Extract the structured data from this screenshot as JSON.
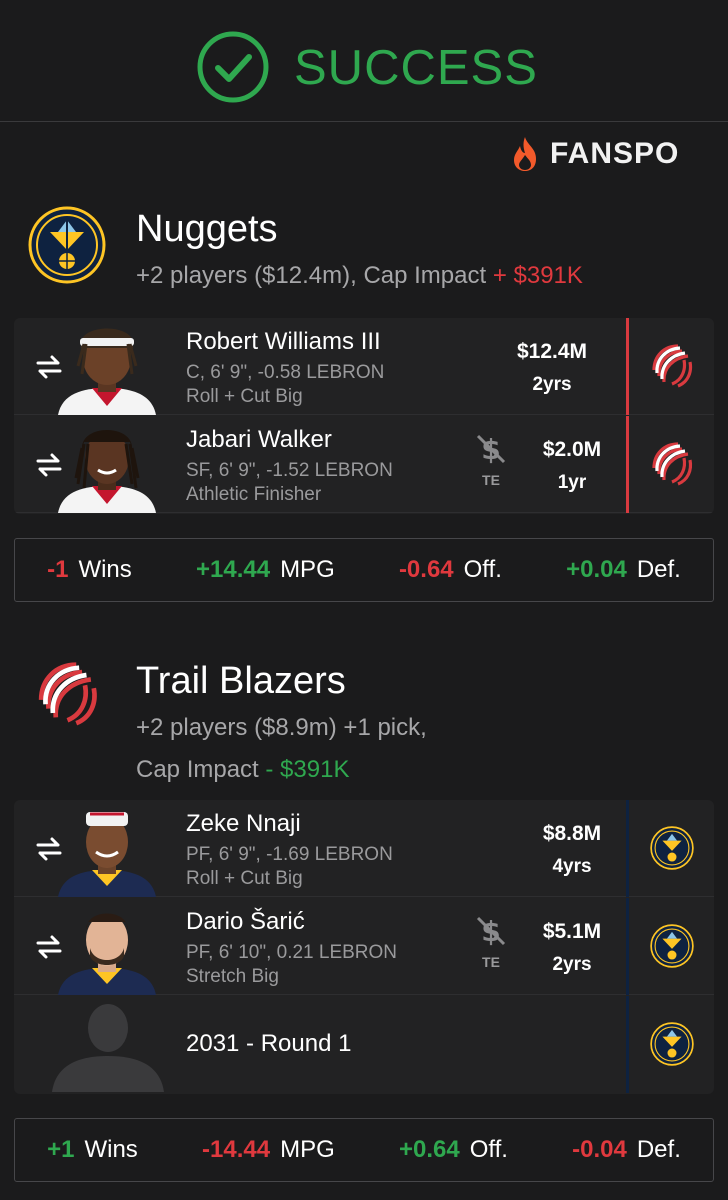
{
  "header": {
    "status": "SUCCESS"
  },
  "brand": {
    "name": "FANSPO"
  },
  "nuggets": {
    "name": "Nuggets",
    "summary": "+2 players ($12.4m), Cap Impact",
    "cap_impact": "+ $391K",
    "players": [
      {
        "name": "Robert Williams III",
        "info": "C, 6' 9\", -0.58 LEBRON",
        "role": "Roll + Cut Big",
        "salary": "$12.4M",
        "years": "2yrs",
        "te": ""
      },
      {
        "name": "Jabari Walker",
        "info": "SF, 6' 9\", -1.52 LEBRON",
        "role": "Athletic Finisher",
        "salary": "$2.0M",
        "years": "1yr",
        "te": "TE"
      }
    ],
    "stats": [
      {
        "value": "-1",
        "label": "Wins",
        "sign": "neg"
      },
      {
        "value": "+14.44",
        "label": "MPG",
        "sign": "pos"
      },
      {
        "value": "-0.64",
        "label": "Off.",
        "sign": "neg"
      },
      {
        "value": "+0.04",
        "label": "Def.",
        "sign": "pos"
      }
    ]
  },
  "blazers": {
    "name": "Trail Blazers",
    "summary_line1": "+2 players ($8.9m) +1 pick,",
    "summary_line2": "Cap Impact",
    "cap_impact": "- $391K",
    "players": [
      {
        "name": "Zeke Nnaji",
        "info": "PF, 6' 9\", -1.69 LEBRON",
        "role": "Roll + Cut Big",
        "salary": "$8.8M",
        "years": "4yrs",
        "te": ""
      },
      {
        "name": "Dario Šarić",
        "info": "PF, 6' 10\", 0.21 LEBRON",
        "role": "Stretch Big",
        "salary": "$5.1M",
        "years": "2yrs",
        "te": "TE"
      }
    ],
    "pick": {
      "label": "2031 - Round 1"
    },
    "stats": [
      {
        "value": "+1",
        "label": "Wins",
        "sign": "pos"
      },
      {
        "value": "-14.44",
        "label": "MPG",
        "sign": "neg"
      },
      {
        "value": "+0.64",
        "label": "Off.",
        "sign": "pos"
      },
      {
        "value": "-0.04",
        "label": "Def.",
        "sign": "neg"
      }
    ]
  },
  "colors": {
    "success": "#2fa84f",
    "negative": "#e0393e",
    "blazers_red": "#d93a3f",
    "nuggets_navy": "#0e2240",
    "nuggets_gold": "#fec524"
  },
  "icons": {
    "status": "check-circle-icon",
    "brand": "flame-icon",
    "swap": "swap-arrows-icon",
    "te": "no-dollar-icon"
  }
}
